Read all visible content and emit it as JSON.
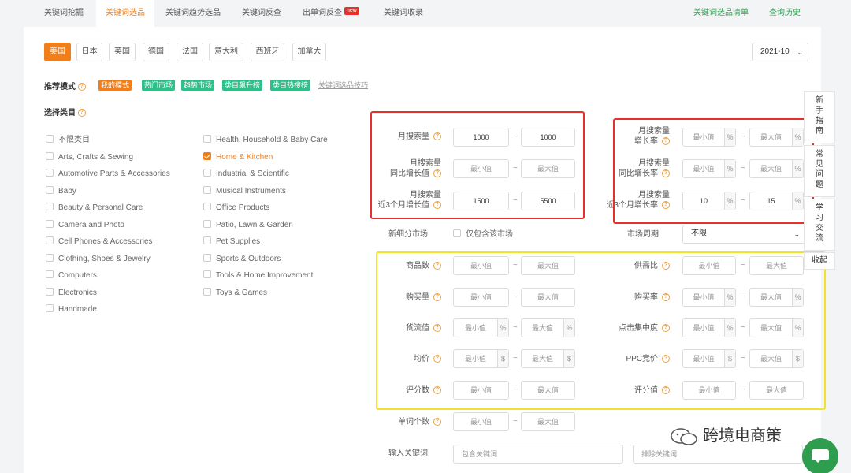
{
  "tabs": [
    {
      "label": "关键词挖掘"
    },
    {
      "label": "关键词选品"
    },
    {
      "label": "关键词趋势选品"
    },
    {
      "label": "关键词反查"
    },
    {
      "label": "出单词反查"
    },
    {
      "label": "关键词收录"
    }
  ],
  "new_badge": "new",
  "right_links": {
    "list": "关键词选品清单",
    "history": "查询历史"
  },
  "countries": [
    "美国",
    "日本",
    "英国",
    "德国",
    "法国",
    "意大利",
    "西班牙",
    "加拿大"
  ],
  "date_select": "2021-10",
  "mode": {
    "label": "推荐模式",
    "options": [
      "我的模式",
      "热门市场",
      "趋势市场",
      "类目飙升榜",
      "类目热搜榜"
    ],
    "tips_link": "关键词选品技巧"
  },
  "category": {
    "label": "选择类目",
    "col1": [
      "不限类目",
      "Arts, Crafts & Sewing",
      "Automotive Parts & Accessories",
      "Baby",
      "Beauty & Personal Care",
      "Camera and Photo",
      "Cell Phones & Accessories",
      "Clothing, Shoes & Jewelry",
      "Computers",
      "Electronics",
      "Handmade"
    ],
    "col2": [
      "Health, Household & Baby Care",
      "Home & Kitchen",
      "Industrial & Scientific",
      "Musical Instruments",
      "Office Products",
      "Patio, Lawn & Garden",
      "Pet Supplies",
      "Sports & Outdoors",
      "Tools & Home Improvement",
      "Toys & Games"
    ],
    "selected": "Home & Kitchen"
  },
  "filters": {
    "monthly_search": {
      "label": "月搜索量",
      "min": "1000",
      "max": "1000"
    },
    "yoy_growth_value": {
      "label1": "月搜索量",
      "label2": "同比增长值",
      "min": "最小值",
      "max": "最大值"
    },
    "three_month_growth_value": {
      "label1": "月搜索量",
      "label2": "近3个月增长值",
      "min": "1500",
      "max": "5500"
    },
    "monthly_growth_rate": {
      "label1": "月搜索量",
      "label2": "增长率",
      "min": "最小值",
      "max": "最大值"
    },
    "yoy_growth_rate": {
      "label1": "月搜索量",
      "label2": "同比增长率",
      "min": "最小值",
      "max": "最大值"
    },
    "three_month_growth_rate": {
      "label1": "月搜索量",
      "label2": "近3个月增长率",
      "min": "10",
      "max": "15"
    },
    "new_market": {
      "label": "新细分市场",
      "checkbox": "仅包含该市场"
    },
    "market_cycle": {
      "label": "市场周期",
      "value": "不限"
    },
    "product_count": {
      "label": "商品数",
      "min": "最小值",
      "max": "最大值"
    },
    "supply_demand": {
      "label": "供需比",
      "min": "最小值",
      "max": "最大值"
    },
    "purchase_volume": {
      "label": "购买量",
      "min": "最小值",
      "max": "最大值"
    },
    "purchase_rate": {
      "label": "购买率",
      "min": "最小值",
      "max": "最大值"
    },
    "monopoly": {
      "label": "货流值",
      "min": "最小值",
      "max": "最大值"
    },
    "click_concentration": {
      "label": "点击集中度",
      "min": "最小值",
      "max": "最大值"
    },
    "avg_price": {
      "label": "均价",
      "min": "最小值",
      "max": "最大值"
    },
    "ppc_bid": {
      "label": "PPC竞价",
      "min": "最小值",
      "max": "最大值"
    },
    "review_count": {
      "label": "评分数",
      "min": "最小值",
      "max": "最大值"
    },
    "rating": {
      "label": "评分值",
      "min": "最小值",
      "max": "最大值"
    },
    "word_count": {
      "label": "单词个数",
      "min": "最小值",
      "max": "最大值"
    },
    "keyword_input": {
      "label": "输入关键词",
      "include": "包含关键词",
      "exclude": "排除关键词"
    }
  },
  "units": {
    "percent": "%",
    "dollar": "$"
  },
  "side_tabs": [
    "新手指南",
    "常见问题",
    "学习交流",
    "收起"
  ],
  "watermark": "跨境电商策",
  "colors": {
    "accent": "#f07f1b",
    "green": "#2fbf8a",
    "red_box": "#e8302a",
    "yellow_box": "#f3e12a"
  }
}
